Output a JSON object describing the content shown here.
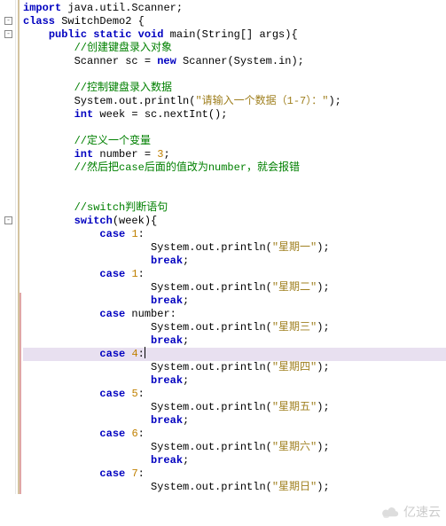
{
  "lines": [
    {
      "indent": 0,
      "tokens": [
        [
          "kw",
          "import"
        ],
        [
          "ident",
          " java.util.Scanner;"
        ]
      ]
    },
    {
      "indent": 0,
      "tokens": [
        [
          "kw",
          "class"
        ],
        [
          "cls",
          " SwitchDemo2 "
        ],
        [
          "punct",
          "{"
        ]
      ]
    },
    {
      "indent": 1,
      "tokens": [
        [
          "kw",
          "public static void"
        ],
        [
          "ident",
          " main(String[] args)"
        ],
        [
          "punct",
          "{"
        ]
      ]
    },
    {
      "indent": 2,
      "tokens": [
        [
          "comment",
          "//创建键盘录入对象"
        ]
      ]
    },
    {
      "indent": 2,
      "tokens": [
        [
          "ident",
          "Scanner sc = "
        ],
        [
          "kw",
          "new"
        ],
        [
          "ident",
          " Scanner(System.in);"
        ]
      ]
    },
    {
      "indent": 2,
      "tokens": []
    },
    {
      "indent": 2,
      "tokens": [
        [
          "comment",
          "//控制键盘录入数据"
        ]
      ]
    },
    {
      "indent": 2,
      "tokens": [
        [
          "ident",
          "System.out.println("
        ],
        [
          "string",
          "\"请输入一个数据（1-7）：\""
        ],
        [
          "ident",
          ");"
        ]
      ]
    },
    {
      "indent": 2,
      "tokens": [
        [
          "kw",
          "int"
        ],
        [
          "ident",
          " week = sc.nextInt();"
        ]
      ]
    },
    {
      "indent": 2,
      "tokens": []
    },
    {
      "indent": 2,
      "tokens": [
        [
          "comment",
          "//定义一个变量"
        ]
      ]
    },
    {
      "indent": 2,
      "tokens": [
        [
          "kw",
          "int"
        ],
        [
          "ident",
          " number = "
        ],
        [
          "num",
          "3"
        ],
        [
          "ident",
          ";"
        ]
      ]
    },
    {
      "indent": 2,
      "tokens": [
        [
          "comment",
          "//然后把case后面的值改为number，就会报错"
        ]
      ]
    },
    {
      "indent": 2,
      "tokens": []
    },
    {
      "indent": 2,
      "tokens": []
    },
    {
      "indent": 2,
      "tokens": [
        [
          "comment",
          "//switch判断语句"
        ]
      ]
    },
    {
      "indent": 2,
      "tokens": [
        [
          "kw",
          "switch"
        ],
        [
          "ident",
          "(week)"
        ],
        [
          "punct",
          "{"
        ]
      ]
    },
    {
      "indent": 3,
      "tokens": [
        [
          "kw",
          "case"
        ],
        [
          "ident",
          " "
        ],
        [
          "num",
          "1"
        ],
        [
          "ident",
          ":"
        ]
      ]
    },
    {
      "indent": 5,
      "tokens": [
        [
          "ident",
          "System.out.println("
        ],
        [
          "string",
          "\"星期一\""
        ],
        [
          "ident",
          ");"
        ]
      ]
    },
    {
      "indent": 5,
      "tokens": [
        [
          "kw",
          "break"
        ],
        [
          "ident",
          ";"
        ]
      ]
    },
    {
      "indent": 3,
      "tokens": [
        [
          "kw",
          "case"
        ],
        [
          "ident",
          " "
        ],
        [
          "num",
          "1"
        ],
        [
          "ident",
          ":"
        ]
      ]
    },
    {
      "indent": 5,
      "tokens": [
        [
          "ident",
          "System.out.println("
        ],
        [
          "string",
          "\"星期二\""
        ],
        [
          "ident",
          ");"
        ]
      ]
    },
    {
      "indent": 5,
      "tokens": [
        [
          "kw",
          "break"
        ],
        [
          "ident",
          ";"
        ]
      ]
    },
    {
      "indent": 3,
      "tokens": [
        [
          "kw",
          "case"
        ],
        [
          "ident",
          " number:"
        ]
      ]
    },
    {
      "indent": 5,
      "tokens": [
        [
          "ident",
          "System.out.println("
        ],
        [
          "string",
          "\"星期三\""
        ],
        [
          "ident",
          ");"
        ]
      ]
    },
    {
      "indent": 5,
      "tokens": [
        [
          "kw",
          "break"
        ],
        [
          "ident",
          ";"
        ]
      ]
    },
    {
      "indent": 3,
      "highlighted": true,
      "cursor": true,
      "tokens": [
        [
          "kw",
          "case"
        ],
        [
          "ident",
          " "
        ],
        [
          "num",
          "4"
        ],
        [
          "ident",
          ":"
        ]
      ]
    },
    {
      "indent": 5,
      "tokens": [
        [
          "ident",
          "System.out.println("
        ],
        [
          "string",
          "\"星期四\""
        ],
        [
          "ident",
          ");"
        ]
      ]
    },
    {
      "indent": 5,
      "tokens": [
        [
          "kw",
          "break"
        ],
        [
          "ident",
          ";"
        ]
      ]
    },
    {
      "indent": 3,
      "tokens": [
        [
          "kw",
          "case"
        ],
        [
          "ident",
          " "
        ],
        [
          "num",
          "5"
        ],
        [
          "ident",
          ":"
        ]
      ]
    },
    {
      "indent": 5,
      "tokens": [
        [
          "ident",
          "System.out.println("
        ],
        [
          "string",
          "\"星期五\""
        ],
        [
          "ident",
          ");"
        ]
      ]
    },
    {
      "indent": 5,
      "tokens": [
        [
          "kw",
          "break"
        ],
        [
          "ident",
          ";"
        ]
      ]
    },
    {
      "indent": 3,
      "tokens": [
        [
          "kw",
          "case"
        ],
        [
          "ident",
          " "
        ],
        [
          "num",
          "6"
        ],
        [
          "ident",
          ":"
        ]
      ]
    },
    {
      "indent": 5,
      "tokens": [
        [
          "ident",
          "System.out.println("
        ],
        [
          "string",
          "\"星期六\""
        ],
        [
          "ident",
          ");"
        ]
      ]
    },
    {
      "indent": 5,
      "tokens": [
        [
          "kw",
          "break"
        ],
        [
          "ident",
          ";"
        ]
      ]
    },
    {
      "indent": 3,
      "tokens": [
        [
          "kw",
          "case"
        ],
        [
          "ident",
          " "
        ],
        [
          "num",
          "7"
        ],
        [
          "ident",
          ":"
        ]
      ]
    },
    {
      "indent": 5,
      "tokens": [
        [
          "ident",
          "System.out.println("
        ],
        [
          "string",
          "\"星期日\""
        ],
        [
          "ident",
          ");"
        ]
      ]
    }
  ],
  "fold_positions": [
    1,
    2,
    16
  ],
  "watermark": "亿速云"
}
